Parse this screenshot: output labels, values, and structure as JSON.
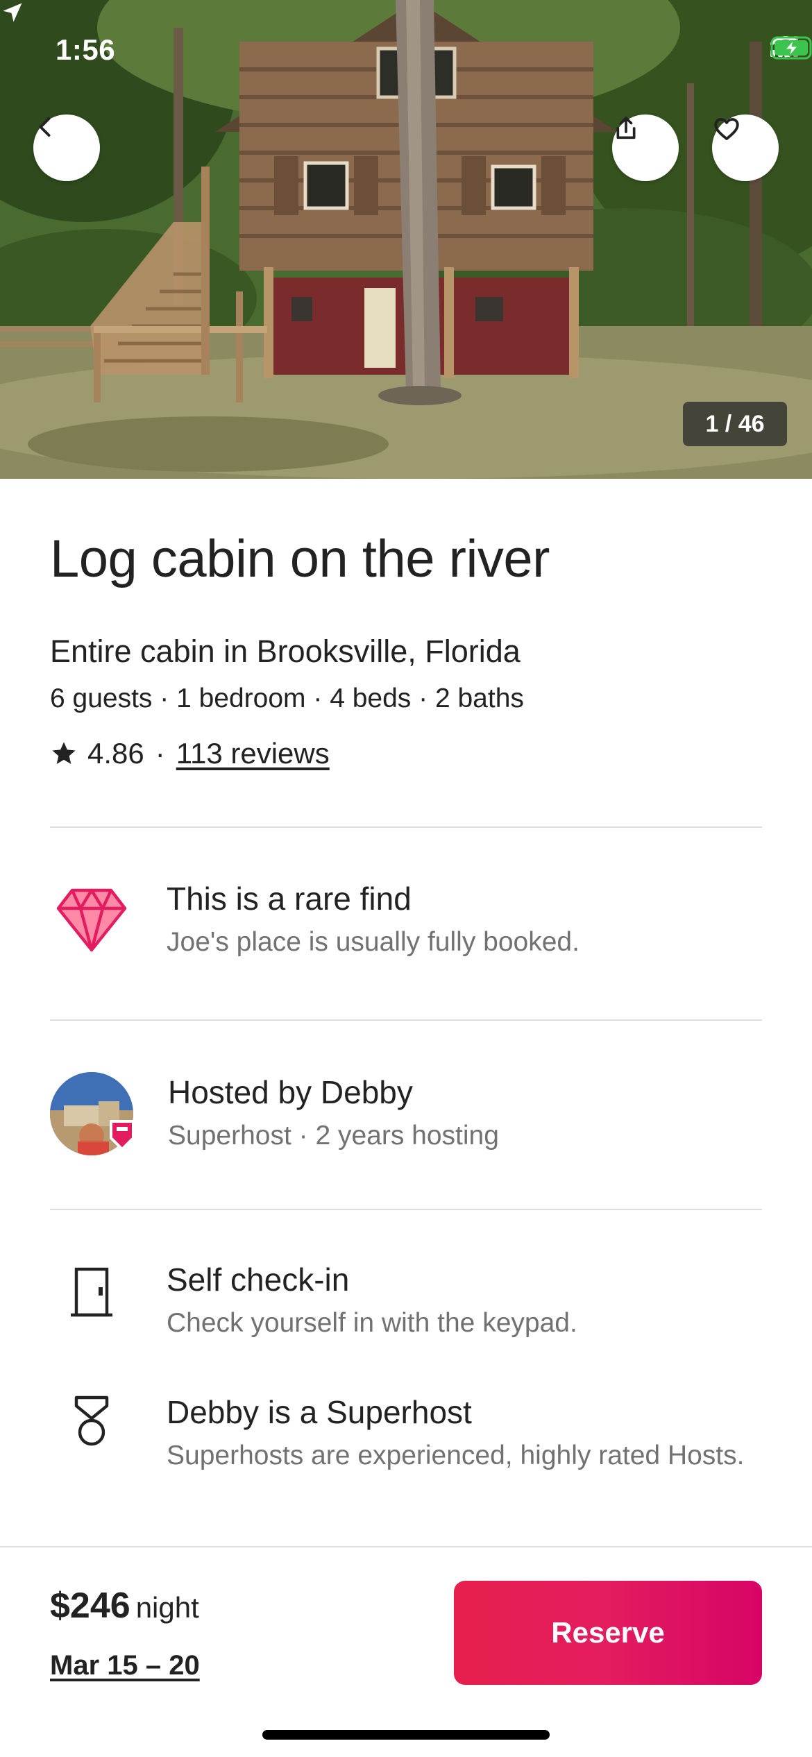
{
  "status_bar": {
    "time": "1:56"
  },
  "hero": {
    "photo_counter": "1 / 46"
  },
  "listing": {
    "title": "Log cabin on the river",
    "subtitle": "Entire cabin in Brooksville, Florida",
    "specs": "6 guests · 1 bedroom · 4 beds · 2 baths",
    "rating": "4.86",
    "separator": "·",
    "reviews": "113 reviews"
  },
  "highlights": {
    "rare_find": {
      "title": "This is a rare find",
      "subtitle": "Joe's place is usually fully booked.",
      "icon": "diamond-icon"
    },
    "host": {
      "title": "Hosted by Debby",
      "subtitle": "Superhost · 2 years hosting"
    },
    "self_checkin": {
      "title": "Self check-in",
      "subtitle": "Check yourself in with the keypad.",
      "icon": "door-icon"
    },
    "superhost": {
      "title": "Debby is a Superhost",
      "subtitle": "Superhosts are experienced, highly rated Hosts.",
      "icon": "medal-icon"
    }
  },
  "footer": {
    "price": "$246",
    "price_unit": "night",
    "dates": "Mar 15 – 20",
    "reserve_label": "Reserve"
  },
  "colors": {
    "brand": "#E31C5F",
    "text": "#222222",
    "muted": "#717171",
    "divider": "#DDDDDD"
  }
}
